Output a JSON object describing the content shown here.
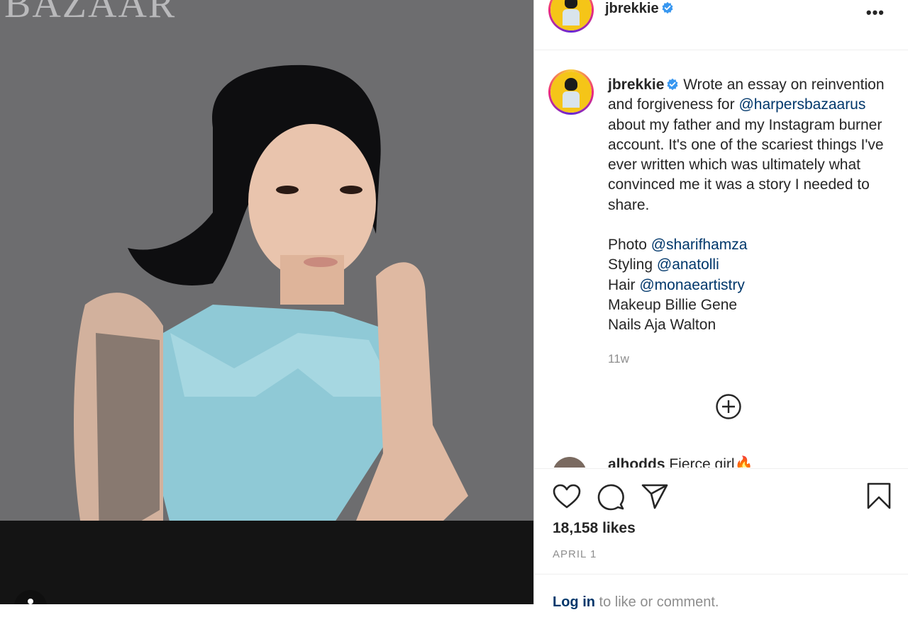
{
  "photo": {
    "magazine_mark": "BAZAAR"
  },
  "header": {
    "username": "jbrekkie",
    "verified_icon": "verified-badge-icon",
    "more_icon": "more-options-icon",
    "more_label": "•••"
  },
  "caption": {
    "username": "jbrekkie",
    "text_before_mention": "Wrote an essay on reinvention and forgiveness for",
    "mention_1": "@harpersbazaarus",
    "text_after_mention": "about my father and my Instagram burner account. It's one of the scariest things I've ever written which was ultimately what convinced me it was a story I needed to share.",
    "credits": [
      {
        "label": "Photo",
        "handle": "@sharifhamza"
      },
      {
        "label": "Styling",
        "handle": "@anatolli"
      },
      {
        "label": "Hair",
        "handle": "@monaeartistry"
      },
      {
        "label": "Makeup Billie Gene",
        "handle": ""
      },
      {
        "label": "Nails Aja Walton",
        "handle": ""
      }
    ],
    "time_ago": "11w"
  },
  "load_more_icon": "plus-circle-icon",
  "comment_peek": {
    "username": "alhodds",
    "text": "Fierce girl🔥"
  },
  "actions": {
    "like_icon": "heart-icon",
    "comment_icon": "comment-icon",
    "share_icon": "paper-plane-icon",
    "save_icon": "bookmark-icon",
    "likes": "18,158 likes",
    "date": "APRIL 1"
  },
  "login": {
    "link": "Log in",
    "text": "to like or comment."
  },
  "colors": {
    "mention": "#00376b",
    "muted": "#8e8e8e",
    "verified": "#3897f0"
  }
}
